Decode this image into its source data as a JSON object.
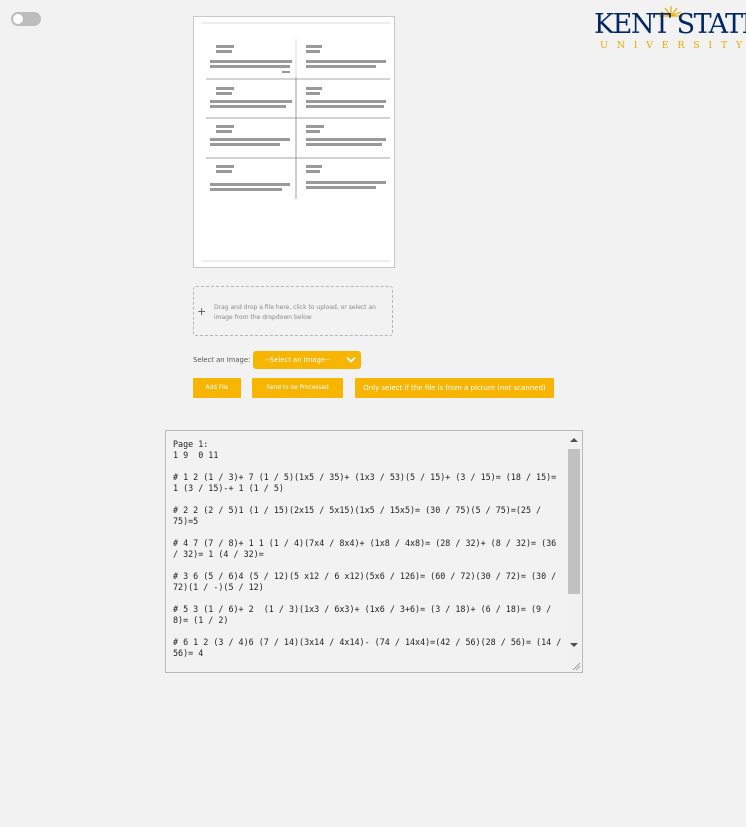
{
  "header": {
    "logo_main": "KENT STATE",
    "logo_sub": "UNIVERSITY",
    "brand_navy": "#002664",
    "brand_gold": "#eaab00"
  },
  "theme_toggle": {
    "state": "off"
  },
  "upload": {
    "dropzone_hint": "Drag and drop a file here, click to upload, or select an image from the dropdown below",
    "select_label": "Select an Image:",
    "select_value": "--Select an Image--",
    "add_file_label": "Add File",
    "send_label": "Send to be Processed",
    "picture_label": "Only select if the file is from a picture (not scanned)",
    "accent": "#f7b500"
  },
  "output": {
    "text": "Page 1:\n1 9  0 11\n\n# 1 2 (1 / 3)+ 7 (1 / 5)(1x5 / 35)+ (1x3 / 53)(5 / 15)+ (3 / 15)= (18 / 15)= 1 (3 / 15)-+ 1 (1 / 5)\n\n# 2 2 (2 / 5)1 (1 / 15)(2x15 / 5x15)(1x5 / 15x5)= (30 / 75)(5 / 75)=(25 / 75)=5\n\n# 4 7 (7 / 8)+ 1 1 (1 / 4)(7x4 / 8x4)+ (1x8 / 4x8)= (28 / 32)+ (8 / 32)= (36 / 32)= 1 (4 / 32)=\n\n# 3 6 (5 / 6)4 (5 / 12)(5 x12 / 6 x12)(5x6 / 126)= (60 / 72)(30 / 72)= (30 / 72)(1 / -)(5 / 12)\n\n# 5 3 (1 / 6)+ 2  (1 / 3)(1x3 / 6x3)+ (1x6 / 3+6)= (3 / 18)+ (6 / 18)= (9 / 8)= (1 / 2)\n\n# 6 1 2 (3 / 4)6 (7 / 14)(3x14 / 4x14)- (74 / 14x4)=(42 / 56)(28 / 56)= (14 / 56)= 4"
  }
}
